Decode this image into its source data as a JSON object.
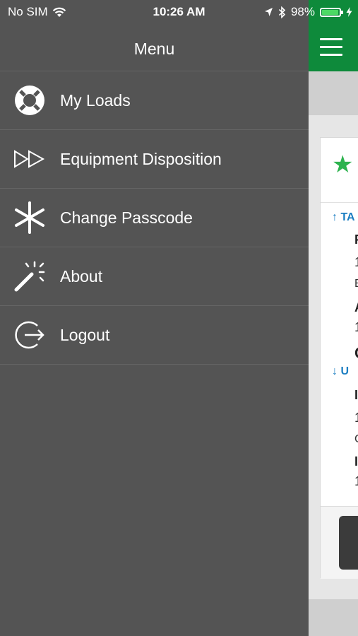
{
  "status_bar": {
    "carrier": "No SIM",
    "time": "10:26 AM",
    "battery_percent": "98%",
    "battery_level": 0.98
  },
  "menu": {
    "title": "Menu",
    "items": [
      {
        "label": "My Loads",
        "icon": "life-ring-icon"
      },
      {
        "label": "Equipment Disposition",
        "icon": "fast-forward-icon"
      },
      {
        "label": "Change Passcode",
        "icon": "asterisk-icon"
      },
      {
        "label": "About",
        "icon": "magic-wand-icon"
      },
      {
        "label": "Logout",
        "icon": "logout-icon"
      }
    ]
  },
  "background_screen": {
    "header_color": "#0e8a3b",
    "star_color": "#2eb34f",
    "section_top_label": "TA",
    "section_bottom_label": "U",
    "card_lines": [
      "P",
      "1",
      "E",
      "A",
      "1",
      "C",
      "I",
      "1",
      "C",
      "I",
      "1"
    ]
  }
}
